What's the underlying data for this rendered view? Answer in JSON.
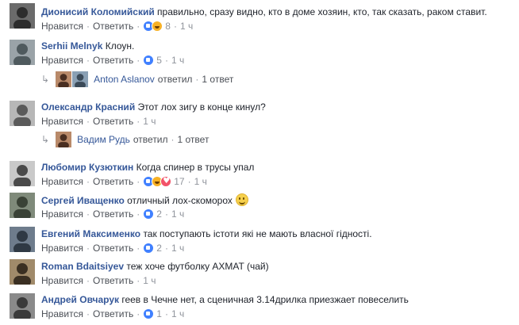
{
  "comments": [
    {
      "author": "Дионисий Коломийский",
      "text": "правильно, сразу видно, кто в доме хозяин, кто, так сказать, раком ставит.",
      "like": "Нравится",
      "reply": "Ответить",
      "reactions": [
        "like",
        "haha"
      ],
      "count": "8",
      "time": "1 ч"
    },
    {
      "author": "Serhii Melnyk",
      "text": "Клоун.",
      "like": "Нравится",
      "reply": "Ответить",
      "reactions": [
        "like"
      ],
      "count": "5",
      "time": "1 ч",
      "replies": {
        "name": "Anton Aslanov",
        "verb": "ответил",
        "count": "1 ответ"
      }
    },
    {
      "author": "Олександр Красний",
      "text": "Этот лох зигу в конце кинул?",
      "like": "Нравится",
      "reply": "Ответить",
      "reactions": [],
      "count": "",
      "time": "1 ч",
      "replies": {
        "name": "Вадим Рудь",
        "verb": "ответил",
        "count": "1 ответ"
      }
    },
    {
      "author": "Любомир Кузюткин",
      "text": "Когда спинер в трусы упал",
      "like": "Нравится",
      "reply": "Ответить",
      "reactions": [
        "like",
        "haha",
        "love"
      ],
      "count": "17",
      "time": "1 ч"
    },
    {
      "author": "Сергей Иващенко",
      "text": "отличный лох-скоморох",
      "emoji": "smile-emoji",
      "like": "Нравится",
      "reply": "Ответить",
      "reactions": [
        "like"
      ],
      "count": "2",
      "time": "1 ч"
    },
    {
      "author": "Евгений Максименко",
      "text": "так поступають істоти які не мають власної гідності.",
      "like": "Нравится",
      "reply": "Ответить",
      "reactions": [
        "like"
      ],
      "count": "2",
      "time": "1 ч"
    },
    {
      "author": "Roman Bdaitsiyev",
      "text": "теж хоче футболку AXMAT (чай)",
      "like": "Нравится",
      "reply": "Ответить",
      "reactions": [],
      "count": "",
      "time": "1 ч"
    },
    {
      "author": "Андрей Овчарук",
      "text": "геев в Чечне нет, а сценичная 3.14дрилка приезжает повеселить",
      "like": "Нравится",
      "reply": "Ответить",
      "reactions": [
        "like"
      ],
      "count": "1",
      "time": "1 ч"
    }
  ],
  "separator": "·",
  "reply_arrow": "↳",
  "colors": {
    "link": "#365899",
    "meta": "#90949c",
    "like_blue": "#4080ff"
  }
}
